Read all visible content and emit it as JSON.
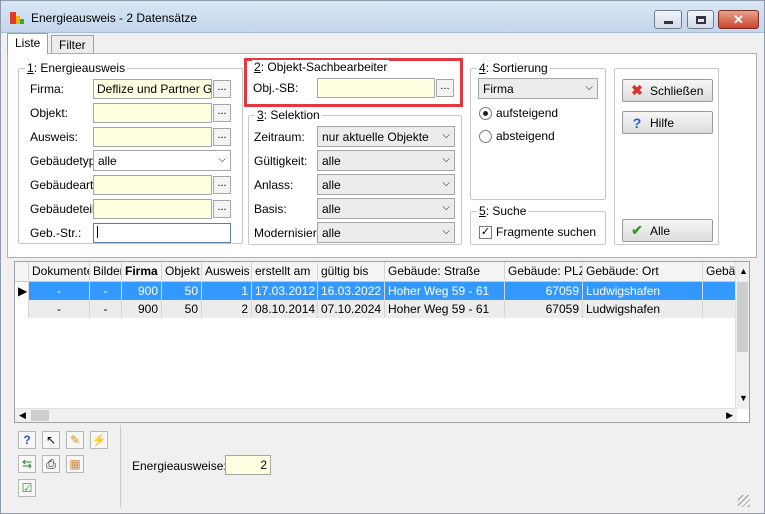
{
  "window": {
    "title": "Energieausweis - 2 Datensätze"
  },
  "tabs": [
    {
      "label": "Liste"
    },
    {
      "label": "Filter"
    }
  ],
  "energieausweis": {
    "legend_num": "1",
    "legend_rest": ": Energieausweis",
    "firma_label": "Firma:",
    "firma_value": "Deflize und Partner Gml",
    "objekt_label": "Objekt:",
    "ausweis_label": "Ausweis:",
    "gebaeudetyp_label": "Gebäudetyp:",
    "gebaeudetyp_value": "alle",
    "gebaeudeart_label": "Gebäudeart:",
    "gebaeudeteil_label": "Gebäudeteil:",
    "gebstr_label": "Geb.-Str.:"
  },
  "objektsb": {
    "legend_num": "2",
    "legend_rest": ": Objekt-Sachbearbeiter",
    "label": "Obj.-SB:"
  },
  "selektion": {
    "legend_num": "3",
    "legend_rest": ": Selektion",
    "zeitraum_label": "Zeitraum:",
    "zeitraum_value": "nur aktuelle Objekte",
    "gueltigkeit_label": "Gültigkeit:",
    "gueltigkeit_value": "alle",
    "anlass_label": "Anlass:",
    "anlass_value": "alle",
    "basis_label": "Basis:",
    "basis_value": "alle",
    "modernisier_label": "Modernisier.:",
    "modernisier_value": "alle"
  },
  "sortierung": {
    "legend_num": "4",
    "legend_rest": ": Sortierung",
    "value": "Firma",
    "asc": "aufsteigend",
    "desc": "absteigend"
  },
  "suche": {
    "legend_num": "5",
    "legend_rest": ": Suche",
    "fragmente": "Fragmente suchen"
  },
  "buttons": {
    "schliessen": "Schließen",
    "hilfe": "Hilfe",
    "alle": "Alle"
  },
  "ellipsis": "...",
  "grid": {
    "columns": [
      "Dokumente",
      "Bilder",
      "Firma",
      "Objekt",
      "Ausweis",
      "erstellt am",
      "gültig bis",
      "Gebäude: Straße",
      "Gebäude: PLZ",
      "Gebäude: Ort",
      "Gebä"
    ],
    "rows": [
      [
        "-",
        "-",
        "900",
        "50",
        "1",
        "17.03.2012",
        "16.03.2022",
        "Hoher Weg 59 - 61",
        "67059",
        "Ludwigshafen",
        ""
      ],
      [
        "-",
        "-",
        "900",
        "50",
        "2",
        "08.10.2014",
        "07.10.2024",
        "Hoher Weg 59 - 61",
        "67059",
        "Ludwigshafen",
        ""
      ]
    ]
  },
  "footer": {
    "count_label": "Energieausweise:",
    "count_value": "2"
  },
  "colors": {
    "selection": "#3399ff",
    "highlight": "#e5373f",
    "field_bg": "#ffffe1"
  }
}
